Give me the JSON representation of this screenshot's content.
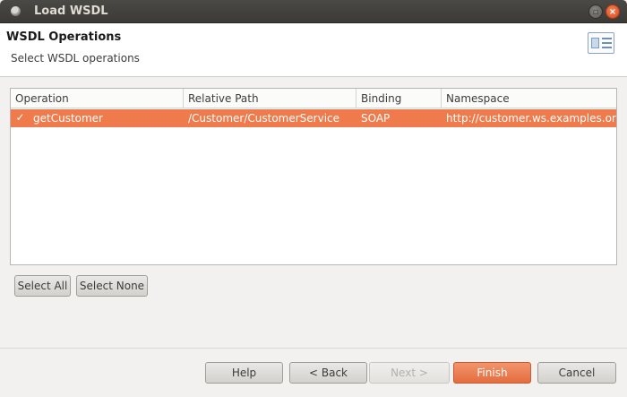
{
  "window": {
    "title": "Load WSDL",
    "maximize_glyph": "▫",
    "close_glyph": "×"
  },
  "header": {
    "title": "WSDL Operations",
    "description": "Select WSDL operations",
    "icon": "wizard-document-icon"
  },
  "table": {
    "columns": [
      "Operation",
      "Relative Path",
      "Binding",
      "Namespace"
    ],
    "rows": [
      {
        "checked": true,
        "check_glyph": "✓",
        "operation": "getCustomer",
        "relative_path": "/Customer/CustomerService",
        "binding": "SOAP",
        "namespace": "http://customer.ws.examples.ora"
      }
    ]
  },
  "selection_buttons": {
    "select_all": "Select All",
    "select_none": "Select None"
  },
  "footer": {
    "help": "Help",
    "back": "< Back",
    "next": "Next >",
    "finish": "Finish",
    "cancel": "Cancel"
  },
  "colors": {
    "selection": "#ef7b4d",
    "titlebar": "#3b3a36",
    "close_button": "#e05a2b"
  }
}
